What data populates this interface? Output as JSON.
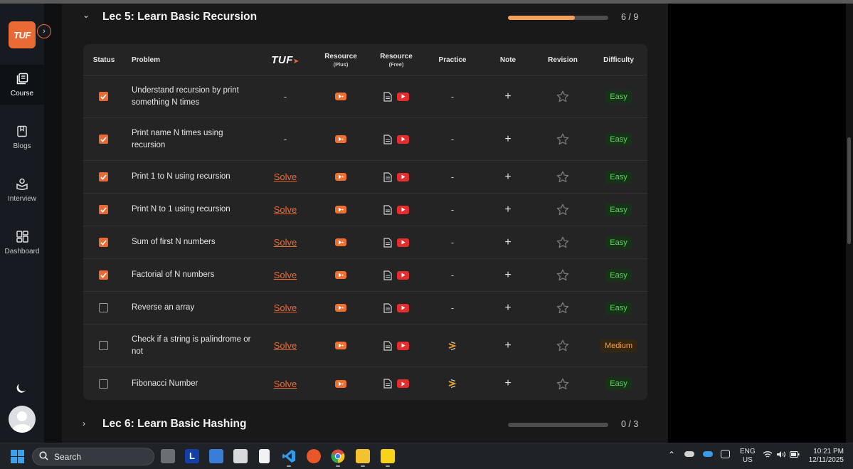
{
  "sidebar": {
    "logo": "TUF",
    "items": [
      {
        "label": "Course",
        "icon": "course-icon",
        "active": true
      },
      {
        "label": "Blogs",
        "icon": "blog-icon",
        "active": false
      },
      {
        "label": "Interview",
        "icon": "interview-icon",
        "active": false
      },
      {
        "label": "Dashboard",
        "icon": "dashboard-icon",
        "active": false
      }
    ]
  },
  "lectures": [
    {
      "title": "Lec 5: Learn Basic Recursion",
      "progress_text": "6 / 9",
      "progress_fraction": 0.667,
      "expanded": true
    },
    {
      "title": "Lec 6: Learn Basic Hashing",
      "progress_text": "0 / 3",
      "progress_fraction": 0,
      "expanded": false
    }
  ],
  "table": {
    "headers": {
      "status": "Status",
      "problem": "Problem",
      "tuf": "TUF",
      "resource_plus": "Resource",
      "resource_plus_sub": "(Plus)",
      "resource_free": "Resource",
      "resource_free_sub": "(Free)",
      "practice": "Practice",
      "note": "Note",
      "revision": "Revision",
      "difficulty": "Difficulty"
    },
    "solve_label": "Solve",
    "dash": "-",
    "rows": [
      {
        "done": true,
        "problem": "Understand recursion by print something N times",
        "tuf": "-",
        "practice": "-",
        "difficulty": "Easy"
      },
      {
        "done": true,
        "problem": "Print name N times using recursion",
        "tuf": "-",
        "practice": "-",
        "difficulty": "Easy"
      },
      {
        "done": true,
        "problem": "Print 1 to N using recursion",
        "tuf": "Solve",
        "practice": "-",
        "difficulty": "Easy"
      },
      {
        "done": true,
        "problem": "Print N to 1 using recursion",
        "tuf": "Solve",
        "practice": "-",
        "difficulty": "Easy"
      },
      {
        "done": true,
        "problem": "Sum of first N numbers",
        "tuf": "Solve",
        "practice": "-",
        "difficulty": "Easy"
      },
      {
        "done": true,
        "problem": "Factorial of N numbers",
        "tuf": "Solve",
        "practice": "-",
        "difficulty": "Easy"
      },
      {
        "done": false,
        "problem": "Reverse an array",
        "tuf": "Solve",
        "practice": "-",
        "difficulty": "Easy"
      },
      {
        "done": false,
        "problem": "Check if a string is palindrome or not",
        "tuf": "Solve",
        "practice": "icon",
        "difficulty": "Medium"
      },
      {
        "done": false,
        "problem": "Fibonacci Number",
        "tuf": "Solve",
        "practice": "icon",
        "difficulty": "Easy"
      }
    ]
  },
  "colors": {
    "accent": "#ea6a35",
    "easy": "#5fd35f",
    "medium": "#f2a24a",
    "progress": "#f4a259"
  },
  "taskbar": {
    "search_label": "Search",
    "lang_top": "ENG",
    "lang_bottom": "US",
    "time": "10:21 PM",
    "date": "12/11/2025"
  }
}
